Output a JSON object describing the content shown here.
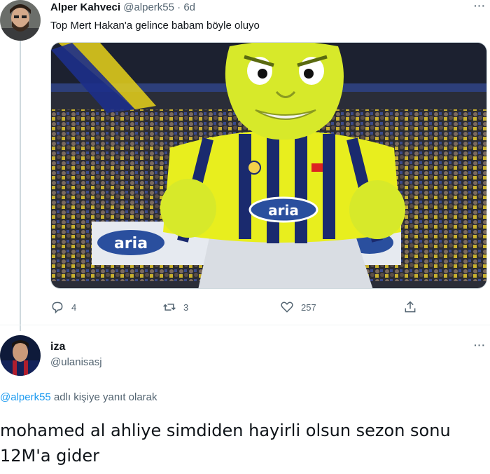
{
  "tweet1": {
    "display_name": "Alper Kahveci",
    "handle": "@alperk55",
    "separator": "·",
    "time": "6d",
    "text": "Top Mert Hakan'a gelince babam böyle oluyo",
    "media": {
      "banner_text": "aria",
      "jersey_text": "aria"
    },
    "actions": {
      "reply_count": "4",
      "retweet_count": "3",
      "like_count": "257"
    },
    "more_label": "···"
  },
  "tweet2": {
    "display_name": "iza",
    "handle": "@ulanisasj",
    "more_label": "···",
    "replying_mention": "@alperk55",
    "replying_suffix": " adlı kişiye yanıt olarak",
    "text": "mohamed al ahliye simdiden hayirli olsun sezon sonu 12M'a gider"
  },
  "colors": {
    "link": "#1d9bf0",
    "muted": "#536471",
    "text": "#0f1419",
    "jersey_yellow": "#e8ee1e",
    "jersey_navy": "#1a2a6e"
  },
  "icons": {
    "reply": "reply-icon",
    "retweet": "retweet-icon",
    "like": "heart-icon",
    "share": "share-icon"
  }
}
